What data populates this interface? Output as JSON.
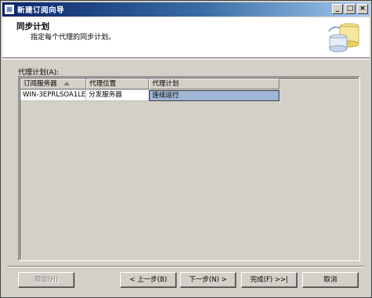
{
  "window": {
    "title": "新建订阅向导"
  },
  "title_controls": {
    "minimize": "_",
    "maximize": "□",
    "close": "×"
  },
  "header": {
    "title": "同步计划",
    "subtitle": "指定每个代理的同步计划。"
  },
  "section": {
    "label": "代理计划(A):"
  },
  "grid": {
    "columns": [
      "订阅服务器",
      "代理位置",
      "代理计划"
    ],
    "rows": [
      {
        "subscriber": "WIN-3EPRLSOA1LE",
        "location": "分发服务器",
        "schedule": "连续运行"
      }
    ]
  },
  "buttons": {
    "help": "帮助(H)",
    "back": "< 上一步(B)",
    "next": "下一步(N) >",
    "finish": "完成(F) >>|",
    "cancel": "取消"
  },
  "colors": {
    "title_start": "#0a246a",
    "title_end": "#a6caf0",
    "selection": "#9fb6d6",
    "face": "#d4d0c8"
  }
}
